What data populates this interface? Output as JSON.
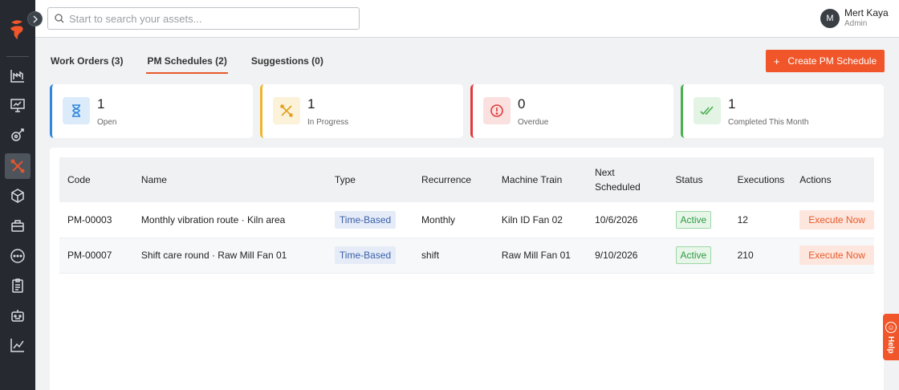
{
  "search": {
    "placeholder": "Start to search your assets..."
  },
  "user": {
    "initial": "M",
    "name": "Mert Kaya",
    "role": "Admin"
  },
  "tabs": [
    {
      "label": "Work Orders (3)",
      "active": false
    },
    {
      "label": "PM Schedules (2)",
      "active": true
    },
    {
      "label": "Suggestions (0)",
      "active": false
    }
  ],
  "actions": {
    "create_plus": "+",
    "create_label": "Create PM Schedule"
  },
  "stats": [
    {
      "value": "1",
      "label": "Open",
      "icon": "hourglass-icon",
      "color": "#2e86de"
    },
    {
      "value": "1",
      "label": "In Progress",
      "icon": "tools-icon",
      "color": "#f0b429"
    },
    {
      "value": "0",
      "label": "Overdue",
      "icon": "alert-circle-icon",
      "color": "#e03b3b"
    },
    {
      "value": "1",
      "label": "Completed This Month",
      "icon": "double-check-icon",
      "color": "#4caf50"
    }
  ],
  "table": {
    "headers": [
      "Code",
      "Name",
      "Type",
      "Recurrence",
      "Machine Train",
      "Next Scheduled",
      "Status",
      "Executions",
      "Actions"
    ],
    "rows": [
      {
        "code": "PM-00003",
        "name": "Monthly vibration route · Kiln area",
        "type": "Time-Based",
        "recurrence": "Monthly",
        "machine_train": "Kiln ID Fan 02",
        "next_scheduled": "10/6/2026",
        "status": "Active",
        "executions": "12",
        "action": "Execute Now"
      },
      {
        "code": "PM-00007",
        "name": "Shift care round · Raw Mill Fan 01",
        "type": "Time-Based",
        "recurrence": "shift",
        "machine_train": "Raw Mill Fan 01",
        "next_scheduled": "9/10/2026",
        "status": "Active",
        "executions": "210",
        "action": "Execute Now"
      }
    ]
  },
  "help": {
    "label": "Help"
  },
  "colors": {
    "accent": "#f0562a",
    "sidebar": "#262a30"
  }
}
